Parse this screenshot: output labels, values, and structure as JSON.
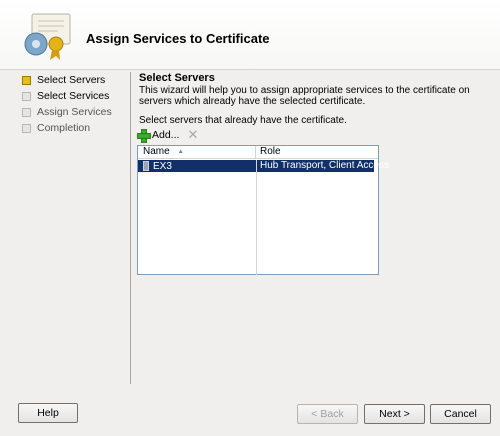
{
  "header": {
    "title": "Assign Services to Certificate",
    "icon": "certificate-icon"
  },
  "steps": [
    {
      "label": "Select Servers",
      "active": true
    },
    {
      "label": "Select Services",
      "active": false
    },
    {
      "label": "Assign Services",
      "active": false
    },
    {
      "label": "Completion",
      "active": false
    }
  ],
  "content": {
    "section_title": "Select Servers",
    "description": "This wizard will help you to assign appropriate services to the certificate on servers which already have the selected certificate.",
    "instruction": "Select servers that already have the certificate.",
    "toolbar": {
      "add_label": "Add...",
      "delete_icon": "delete-icon"
    },
    "grid": {
      "columns": [
        "Name",
        "Role"
      ],
      "rows": [
        {
          "name": "EX3",
          "role": "Hub Transport, Client Access"
        }
      ]
    }
  },
  "buttons": {
    "help": "Help",
    "back": "< Back",
    "next": "Next >",
    "cancel": "Cancel"
  }
}
